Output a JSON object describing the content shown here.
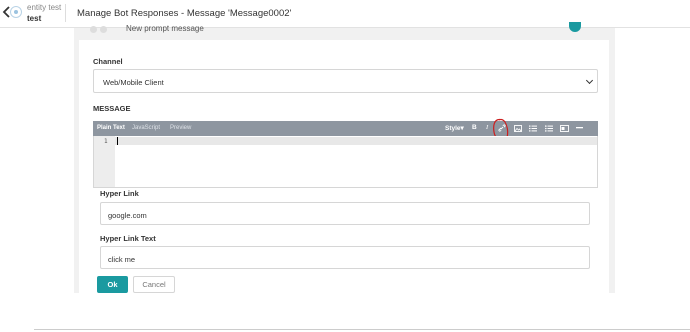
{
  "header": {
    "bot_name": "entity test",
    "bot_sub": "test",
    "title": "Manage Bot Responses - Message 'Message0002'"
  },
  "background": {
    "peek_text": "New prompt message"
  },
  "form": {
    "channel_label": "Channel",
    "channel_value": "Web/Mobile Client",
    "message_label": "MESSAGE",
    "tabs": [
      "Plain Text",
      "JavaScript",
      "Preview"
    ],
    "toolbar": {
      "style": "Style▾",
      "bold": "B",
      "italic": "I"
    },
    "line_number": "1",
    "hyperlink_label": "Hyper Link",
    "hyperlink_value": "google.com",
    "hyperlink_text_label": "Hyper Link Text",
    "hyperlink_text_value": "click me",
    "ok_label": "Ok",
    "cancel_label": "Cancel"
  },
  "colors": {
    "accent": "#1a9aa0",
    "toolbar": "#8e96a0",
    "annotation": "#cc1f1f"
  }
}
